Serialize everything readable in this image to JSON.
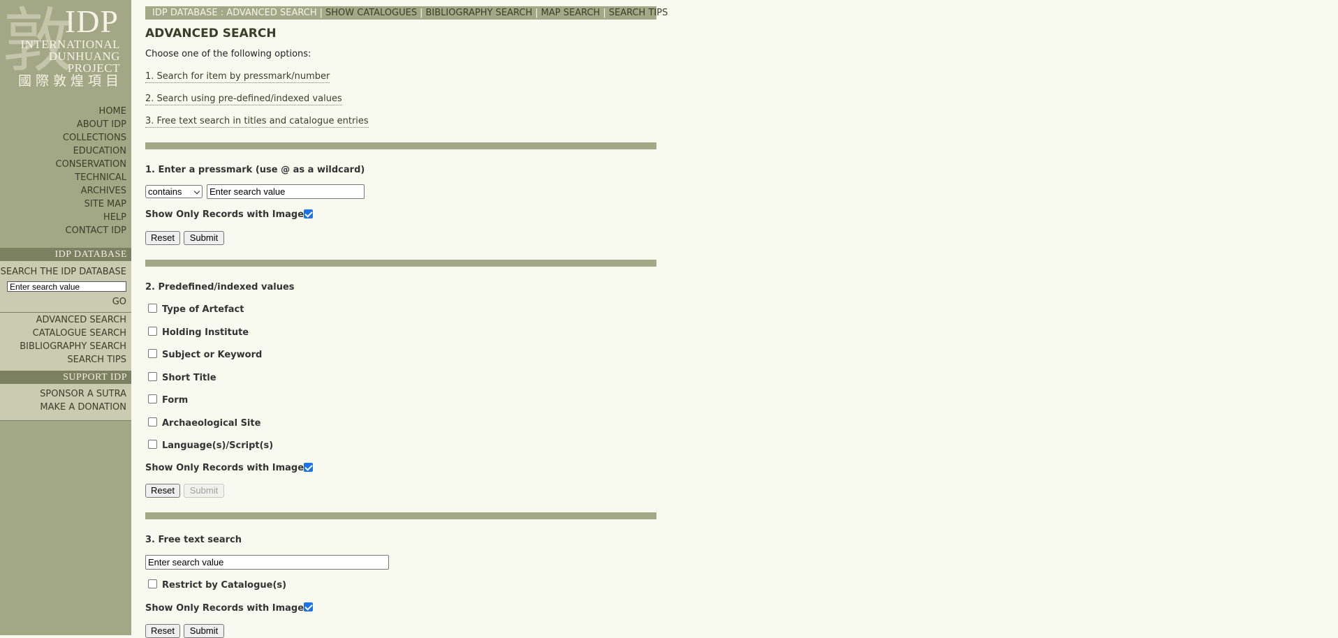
{
  "logo": {
    "glyph": "敦",
    "title": "IDP",
    "line1": "INTERNATIONAL",
    "line2": "DUNHUANG",
    "line3": "PROJECT",
    "chinese": "國際敦煌項目"
  },
  "sidebar": {
    "nav": [
      "HOME",
      "ABOUT IDP",
      "COLLECTIONS",
      "EDUCATION",
      "CONSERVATION",
      "TECHNICAL",
      "ARCHIVES",
      "SITE MAP",
      "HELP",
      "CONTACT IDP"
    ],
    "database_heading": "IDP DATABASE",
    "search_label": "SEARCH THE IDP DATABASE",
    "search_value": "Enter search value",
    "go_label": "GO",
    "search_links": [
      "ADVANCED SEARCH",
      "CATALOGUE SEARCH",
      "BIBLIOGRAPHY SEARCH",
      "SEARCH TIPS"
    ],
    "support_heading": "SUPPORT IDP",
    "support_links": [
      "SPONSOR A SUTRA",
      "MAKE A DONATION"
    ]
  },
  "topnav": {
    "current": "IDP DATABASE : ADVANCED SEARCH",
    "separator": "|",
    "links": [
      "SHOW CATALOGUES",
      "BIBLIOGRAPHY SEARCH",
      "MAP SEARCH",
      "SEARCH TIPS"
    ]
  },
  "main": {
    "title": "ADVANCED SEARCH",
    "intro": "Choose one of the following options:",
    "options": [
      "1. Search for item by pressmark/number",
      "2. Search using pre-defined/indexed values",
      "3. Free text search in titles and catalogue entries"
    ]
  },
  "section1": {
    "heading": "1. Enter a pressmark (use @ as a wildcard)",
    "match_select": "contains",
    "value": "Enter search value",
    "images_label": "Show Only Records with Images",
    "images_checked": true,
    "reset": "Reset",
    "submit": "Submit"
  },
  "section2": {
    "heading": "2. Predefined/indexed values",
    "options": [
      {
        "label": "Type of Artefact",
        "checked": false
      },
      {
        "label": "Holding Institute",
        "checked": false
      },
      {
        "label": "Subject or Keyword",
        "checked": false
      },
      {
        "label": "Short Title",
        "checked": false
      },
      {
        "label": "Form",
        "checked": false
      },
      {
        "label": "Archaeological Site",
        "checked": false
      },
      {
        "label": "Language(s)/Script(s)",
        "checked": false
      }
    ],
    "images_label": "Show Only Records with Images",
    "images_checked": true,
    "reset": "Reset",
    "submit": "Submit",
    "submit_disabled": true
  },
  "section3": {
    "heading": "3. Free text search",
    "value": "Enter search value",
    "restrict_label": "Restrict by Catalogue(s)",
    "restrict_checked": false,
    "images_label": "Show Only Records with Images",
    "images_checked": true,
    "reset": "Reset",
    "submit": "Submit"
  },
  "colors": {
    "sidebar": "#a2a786",
    "accent_bar": "#a3a887",
    "sidebar_band": "#7b8160",
    "sidebar_light": "#c9ccb0",
    "page_background": "#f8f9ef",
    "checkbox_checked": "#1a73e8"
  }
}
